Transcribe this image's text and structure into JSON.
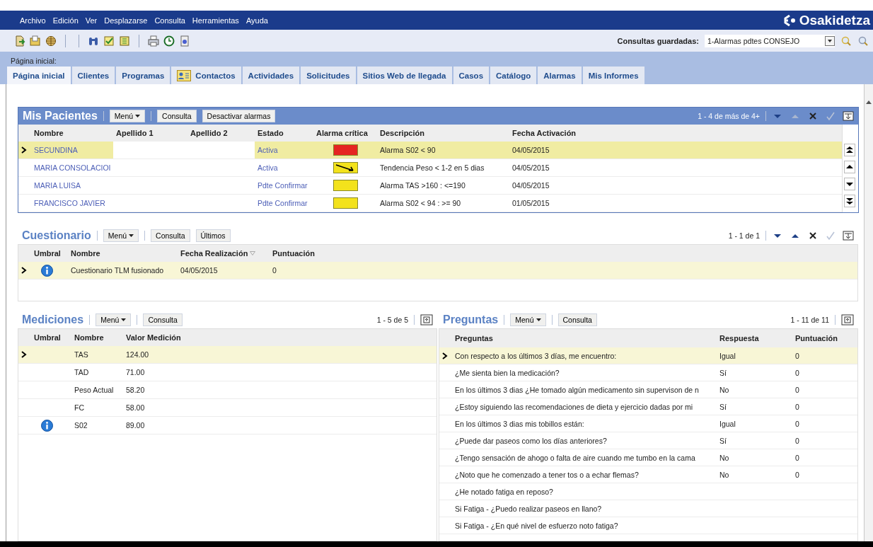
{
  "menu": [
    "Archivo",
    "Edición",
    "Ver",
    "Desplazarse",
    "Consulta",
    "Herramientas",
    "Ayuda"
  ],
  "logo": "Osakidetza",
  "saved_queries": {
    "label": "Consultas guardadas:",
    "value": "1-Alarmas pdtes CONSEJO"
  },
  "breadcrumb": "Página inicial:",
  "tabs": [
    {
      "label": "Página inicial",
      "selected": true,
      "kind": "text"
    },
    {
      "label": "Clientes",
      "selected": false,
      "kind": "text"
    },
    {
      "label": "Programas",
      "selected": false,
      "kind": "text"
    },
    {
      "label": "Contactos",
      "selected": false,
      "kind": "icon"
    },
    {
      "label": "Actividades",
      "selected": false,
      "kind": "text"
    },
    {
      "label": "Solicitudes",
      "selected": false,
      "kind": "text"
    },
    {
      "label": "Sitios Web de llegada",
      "selected": false,
      "kind": "text"
    },
    {
      "label": "Casos",
      "selected": false,
      "kind": "text"
    },
    {
      "label": "Catálogo",
      "selected": false,
      "kind": "text"
    },
    {
      "label": "Alarmas",
      "selected": false,
      "kind": "text"
    },
    {
      "label": "Mis Informes",
      "selected": false,
      "kind": "text"
    }
  ],
  "patients": {
    "title": "Mis Pacientes",
    "buttons": [
      {
        "label": "Menú",
        "kind": "menu"
      },
      {
        "label": "Consulta",
        "kind": "button"
      },
      {
        "label": "Desactivar alarmas",
        "kind": "button"
      }
    ],
    "pager": "1 - 4 de más de 4+",
    "nav": [
      {
        "kind": "down",
        "disabled": false
      },
      {
        "kind": "up",
        "disabled": true
      },
      {
        "kind": "close",
        "disabled": false
      },
      {
        "kind": "check",
        "disabled": true
      },
      {
        "kind": "layout"
      }
    ],
    "columns": [
      "Nombre",
      "Apellido 1",
      "Apellido 2",
      "Estado",
      "Alarma crítica",
      "Descripción",
      "Fecha Activación"
    ],
    "rows": [
      {
        "name": "SECUNDINA",
        "status": "Activa",
        "alarm": {
          "kind": "block",
          "color": "#e52521"
        },
        "description": "Alarma S02 < 90",
        "date": "04/05/2015",
        "selected": true
      },
      {
        "name": "MARIA CONSOLACIOI",
        "status": "Activa",
        "alarm": {
          "kind": "trend",
          "color": "#f3e21c"
        },
        "description": "Tendencia Peso < 1-2 en 5 dias",
        "date": "04/05/2015",
        "selected": false
      },
      {
        "name": "MARIA LUISA",
        "status": "Pdte Confirmar",
        "alarm": {
          "kind": "block",
          "color": "#f3e21c"
        },
        "description": "Alarma TAS >160 : <=190",
        "date": "04/05/2015",
        "selected": false
      },
      {
        "name": "FRANCISCO JAVIER",
        "status": "Pdte Confirmar",
        "alarm": {
          "kind": "block",
          "color": "#f3e21c"
        },
        "description": "Alarma S02 < 94 : >= 90",
        "date": "01/05/2015",
        "selected": false
      }
    ]
  },
  "questionnaire": {
    "title": "Cuestionario",
    "buttons": [
      {
        "label": "Menú",
        "kind": "menu"
      },
      {
        "label": "Consulta",
        "kind": "button"
      },
      {
        "label": "Últimos",
        "kind": "button"
      }
    ],
    "pager": "1 - 1 de 1",
    "nav": [
      {
        "kind": "down",
        "disabled": false
      },
      {
        "kind": "up",
        "disabled": false
      },
      {
        "kind": "close",
        "disabled": false
      },
      {
        "kind": "check",
        "disabled": true
      },
      {
        "kind": "layout"
      }
    ],
    "columns": [
      "Umbral",
      "Nombre",
      "Fecha Realización",
      "Puntuación"
    ],
    "rows": [
      {
        "threshold": true,
        "name": "Cuestionario TLM fusionado",
        "date": "04/05/2015",
        "score": "0",
        "selected": true
      }
    ]
  },
  "measurements": {
    "title": "Mediciones",
    "buttons": [
      {
        "label": "Menú",
        "kind": "menu"
      },
      {
        "label": "Consulta",
        "kind": "button"
      }
    ],
    "pager": "1 - 5 de 5",
    "columns": [
      "Umbral",
      "Nombre",
      "Valor Medición"
    ],
    "rows": [
      {
        "threshold": false,
        "name": "TAS",
        "value": "124.00",
        "selected": true
      },
      {
        "threshold": false,
        "name": "TAD",
        "value": "71.00",
        "selected": false
      },
      {
        "threshold": false,
        "name": "Peso Actual",
        "value": "58.20",
        "selected": false
      },
      {
        "threshold": false,
        "name": "FC",
        "value": "58.00",
        "selected": false
      },
      {
        "threshold": true,
        "name": "S02",
        "value": "89.00",
        "selected": false
      }
    ]
  },
  "questions": {
    "title": "Preguntas",
    "buttons": [
      {
        "label": "Menú",
        "kind": "menu"
      },
      {
        "label": "Consulta",
        "kind": "button"
      }
    ],
    "pager": "1 - 11 de 11",
    "columns": [
      "Preguntas",
      "Respuesta",
      "Puntuación"
    ],
    "rows": [
      {
        "question": "Con respecto a los últimos 3 días, me encuentro:",
        "answer": "Igual",
        "score": "0",
        "selected": true
      },
      {
        "question": "¿Me sienta bien la medicación?",
        "answer": "Sí",
        "score": "0",
        "selected": false
      },
      {
        "question": "En los últimos 3 dias ¿He tomado algún medicamento sin supervison de n",
        "answer": "No",
        "score": "0",
        "selected": false
      },
      {
        "question": "¿Estoy siguiendo las recomendaciones de dieta y ejercicio dadas por mi",
        "answer": "Sí",
        "score": "0",
        "selected": false
      },
      {
        "question": "En los últimos 3 dias mis tobillos están:",
        "answer": "Igual",
        "score": "0",
        "selected": false
      },
      {
        "question": "¿Puede dar paseos como los días anteriores?",
        "answer": "Sí",
        "score": "0",
        "selected": false
      },
      {
        "question": "¿Tengo sensación de ahogo o falta de aire cuando me tumbo en la cama",
        "answer": "No",
        "score": "0",
        "selected": false
      },
      {
        "question": "¿Noto que he comenzado a tener tos o a echar flemas?",
        "answer": "No",
        "score": "0",
        "selected": false
      },
      {
        "question": "¿He notado fatiga en reposo?",
        "selected": false
      },
      {
        "question": "Si Fatiga -  ¿Puedo realizar paseos en llano?",
        "selected": false
      },
      {
        "question": "Si Fatiga - ¿En qué nivel de esfuerzo noto fatiga?",
        "selected": false
      }
    ]
  }
}
